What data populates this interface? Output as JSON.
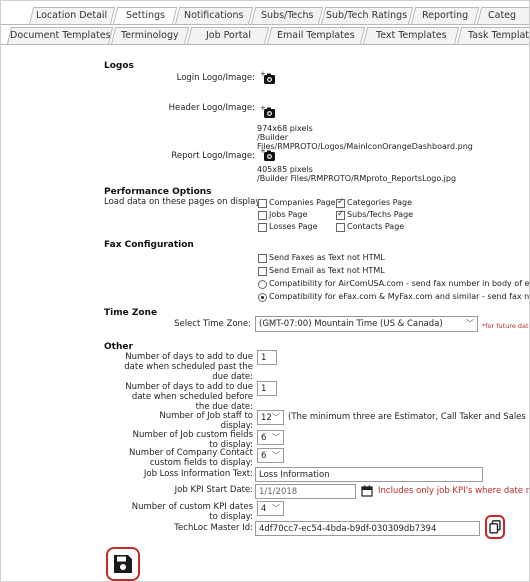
{
  "tabs_row1": [
    {
      "label": "Location Detail",
      "active": false
    },
    {
      "label": "Settings",
      "active": true
    },
    {
      "label": "Notifications",
      "active": false
    },
    {
      "label": "Subs/Techs",
      "active": false
    },
    {
      "label": "Sub/Tech Ratings",
      "active": false
    },
    {
      "label": "Reporting",
      "active": false
    },
    {
      "label": "Categ",
      "active": false
    }
  ],
  "tabs_row2": [
    {
      "label": "Document Templates"
    },
    {
      "label": "Terminology"
    },
    {
      "label": "Job Portal"
    },
    {
      "label": "Email Templates"
    },
    {
      "label": "Text Templates"
    },
    {
      "label": "Task Templat"
    }
  ],
  "logos": {
    "heading": "Logos",
    "login_label": "Login Logo/Image:",
    "header_label": "Header Logo/Image:",
    "header_info": [
      "974x68 pixels",
      "/Builder",
      "Files/RMPROTO/Logos/MainIconOrangeDashboard.png"
    ],
    "report_label": "Report Logo/Image:",
    "report_info": [
      "405x85 pixels",
      "/Builder Files/RMPROTO/RMproto_ReportsLogo.jpg"
    ]
  },
  "performance": {
    "heading": "Performance Options",
    "load_label": "Load data on these pages on display:",
    "options": [
      {
        "label": "Companies Page",
        "checked": false
      },
      {
        "label": "Categories Page",
        "checked": true
      },
      {
        "label": "Jobs Page",
        "checked": false
      },
      {
        "label": "Subs/Techs Page",
        "checked": true
      },
      {
        "label": "Losses Page",
        "checked": false
      },
      {
        "label": "Contacts Page",
        "checked": false
      }
    ]
  },
  "fax": {
    "heading": "Fax Configuration",
    "checks": [
      {
        "label": "Send Faxes as Text not HTML",
        "checked": false
      },
      {
        "label": "Send Email as Text not HTML",
        "checked": false
      }
    ],
    "radios": [
      {
        "label": "Compatibility for AirComUSA.com - send fax number in body of e",
        "selected": false
      },
      {
        "label": "Compatibility for eFax.com & MyFax.com and similar - send fax nu",
        "selected": true
      }
    ]
  },
  "timezone": {
    "heading": "Time Zone",
    "label": "Select Time Zone:",
    "value": "(GMT-07:00) Mountain Time (US & Canada)",
    "note": "*for future dat"
  },
  "other": {
    "heading": "Other",
    "days_past_label": [
      "Number of days to add to due",
      "date when scheduled past the",
      "due date:"
    ],
    "days_past_value": "1",
    "days_before_label": [
      "Number of days to add to due",
      "date when scheduled before",
      "the due date:"
    ],
    "days_before_value": "1",
    "staff_label": [
      "Number of Job staff to",
      "display:"
    ],
    "staff_value": "12",
    "staff_note": "(The minimum three are Estimator, Call Taker and Sales Man",
    "job_custom_label": [
      "Number of Job custom fields",
      "to display:"
    ],
    "job_custom_value": "6",
    "company_custom_label": [
      "Number of Company Contact",
      "custom fields to display:"
    ],
    "company_custom_value": "6",
    "loss_info_label": "Job Loss Information Text:",
    "loss_info_value": "Loss Information",
    "kpi_start_label": "Job KPI Start Date:",
    "kpi_start_value": "1/1/2018",
    "kpi_note": "Includes only job KPI's where date rec",
    "kpi_dates_label": [
      "Number of custom KPI dates",
      "to display:"
    ],
    "kpi_dates_value": "4",
    "master_id_label": "TechLoc Master Id:",
    "master_id_value": "4df70cc7-ec54-4bda-b9df-030309db7394"
  },
  "colors": {
    "highlight": "#c62828"
  }
}
